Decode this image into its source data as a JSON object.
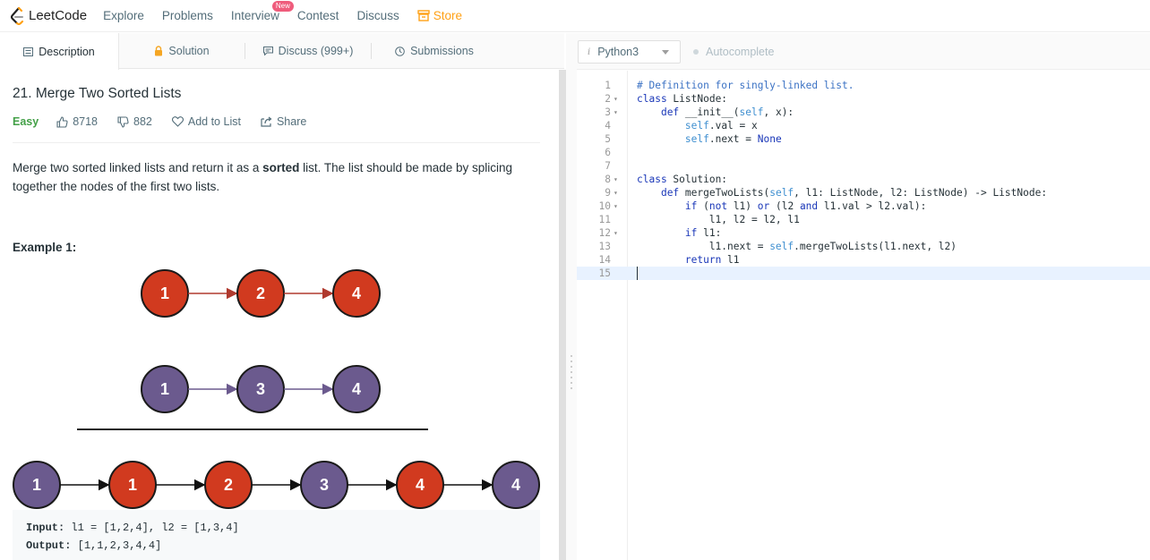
{
  "nav": {
    "logo": "LeetCode",
    "items": [
      "Explore",
      "Problems",
      "Interview",
      "Contest",
      "Discuss"
    ],
    "new_badge": "New",
    "store": "Store"
  },
  "tabs": [
    "Description",
    "Solution",
    "Discuss (999+)",
    "Submissions"
  ],
  "problem": {
    "title": "21. Merge Two Sorted Lists",
    "difficulty": "Easy",
    "likes": "8718",
    "dislikes": "882",
    "add_to_list": "Add to List",
    "share": "Share",
    "desc_before": "Merge two sorted linked lists and return it as a ",
    "desc_bold": "sorted",
    "desc_after": " list. The list should be made by splicing together the nodes of the first two lists.",
    "example_heading": "Example 1:",
    "list1": [
      "1",
      "2",
      "4"
    ],
    "list2": [
      "1",
      "3",
      "4"
    ],
    "merged": [
      "1",
      "1",
      "2",
      "3",
      "4",
      "4"
    ],
    "merged_colors": [
      "purple",
      "red",
      "red",
      "purple",
      "red",
      "purple"
    ],
    "input_label": "Input:",
    "input_value": "l1 = [1,2,4], l2 = [1,3,4]",
    "output_label": "Output:",
    "output_value": "[1,1,2,3,4,4]"
  },
  "editor": {
    "language": "Python3",
    "autocomplete": "Autocomplete",
    "line_numbers": [
      "1",
      "2",
      "3",
      "4",
      "5",
      "6",
      "7",
      "8",
      "9",
      "10",
      "11",
      "12",
      "13",
      "14",
      "15"
    ],
    "lines": [
      "# Definition for singly-linked list.",
      "class ListNode:",
      "    def __init__(self, x):",
      "        self.val = x",
      "        self.next = None",
      "",
      "",
      "class Solution:",
      "    def mergeTwoLists(self, l1: ListNode, l2: ListNode) -> ListNode:",
      "        if (not l1) or (l2 and l1.val > l2.val):",
      "            l1, l2 = l2, l1",
      "        if l1:",
      "            l1.next = self.mergeTwoLists(l1.next, l2)",
      "        return l1",
      ""
    ]
  },
  "colors": {
    "red_node": "#d13a1f",
    "purple_node": "#6b5a8e",
    "accent": "#ffa116",
    "easy": "#43a047"
  }
}
